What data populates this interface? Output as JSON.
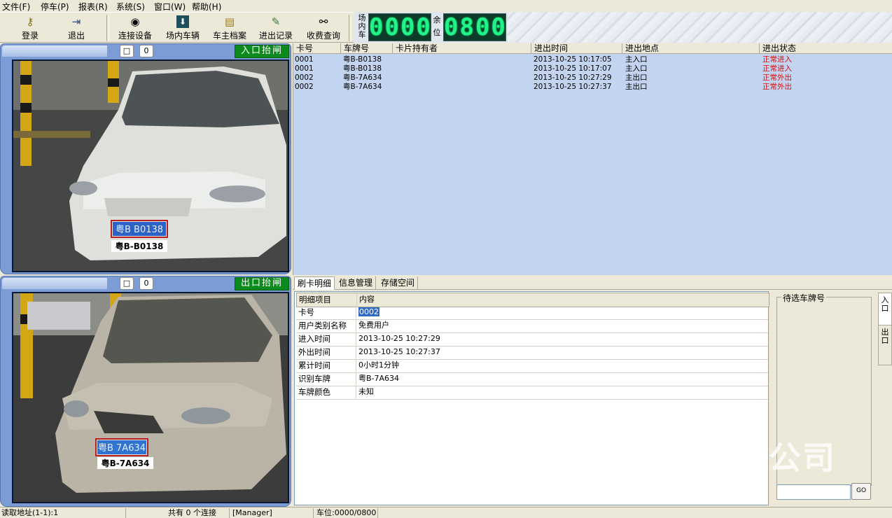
{
  "menu": [
    "文件(F)",
    "停车(P)",
    "报表(R)",
    "系统(S)",
    "窗口(W)",
    "帮助(H)"
  ],
  "toolbar": {
    "login": "登录",
    "exit": "退出",
    "connect": "连接设备",
    "vehicles_in_lot": "场内车辆",
    "owner_records": "车主档案",
    "in_out_records": "进出记录",
    "fee_query": "收费查询"
  },
  "counters": {
    "in_lot_label": [
      "场",
      "内",
      "车"
    ],
    "in_lot_value": "0000",
    "remaining_label": [
      "余",
      "位"
    ],
    "remaining_value": "0800"
  },
  "entry_camera": {
    "tab_a": "□",
    "tab_b": "0",
    "gate_button": "入口抬闸",
    "plate_caption": "粤B-B0138",
    "plate_on_car": "粤B B0138"
  },
  "exit_camera": {
    "tab_a": "□",
    "tab_b": "0",
    "gate_button": "出口抬闸",
    "plate_caption": "粤B-7A634",
    "plate_on_car": "粤B 7A634"
  },
  "records": {
    "headers": [
      "卡号",
      "车牌号",
      "卡片持有者",
      "进出时间",
      "进出地点",
      "进出状态"
    ],
    "rows": [
      {
        "card": "0001",
        "plate": "粤B-B0138",
        "holder": "",
        "time": "2013-10-25 10:17:05",
        "place": "主入口",
        "status": "正常进入"
      },
      {
        "card": "0001",
        "plate": "粤B-B0138",
        "holder": "",
        "time": "2013-10-25 10:17:07",
        "place": "主入口",
        "status": "正常进入"
      },
      {
        "card": "0002",
        "plate": "粤B-7A634",
        "holder": "",
        "time": "2013-10-25 10:27:29",
        "place": "主出口",
        "status": "正常外出"
      },
      {
        "card": "0002",
        "plate": "粤B-7A634",
        "holder": "",
        "time": "2013-10-25 10:27:37",
        "place": "主出口",
        "status": "正常外出"
      }
    ]
  },
  "tabs": [
    "刷卡明细",
    "信息管理",
    "存储空间"
  ],
  "detail": {
    "headers": [
      "明细项目",
      "内容"
    ],
    "rows": [
      {
        "item": "卡号",
        "value": "0002"
      },
      {
        "item": "用户类别名称",
        "value": "免费用户"
      },
      {
        "item": "进入时间",
        "value": "2013-10-25 10:27:29"
      },
      {
        "item": "外出时间",
        "value": "2013-10-25 10:27:37"
      },
      {
        "item": "累计时间",
        "value": "0小时1分钟"
      },
      {
        "item": "识别车牌",
        "value": "粤B-7A634"
      },
      {
        "item": "车牌颜色",
        "value": "未知"
      }
    ]
  },
  "pending": {
    "title": "待选车牌号",
    "input_value": "",
    "go_button": "GO"
  },
  "side_tabs": [
    "入口",
    "出口"
  ],
  "watermark": "公司",
  "statusbar": {
    "read_address": "读取地址(1-1):1",
    "connections": "共有 0 个连接",
    "user": "[Manager]",
    "spaces": "车位:0000/0800"
  },
  "colors": {
    "records_bg": "#c2d4ef",
    "led_green": "#22f28a",
    "gate_green": "#0c8a1e",
    "status_red": "#d41010",
    "selection": "#316ac5"
  }
}
